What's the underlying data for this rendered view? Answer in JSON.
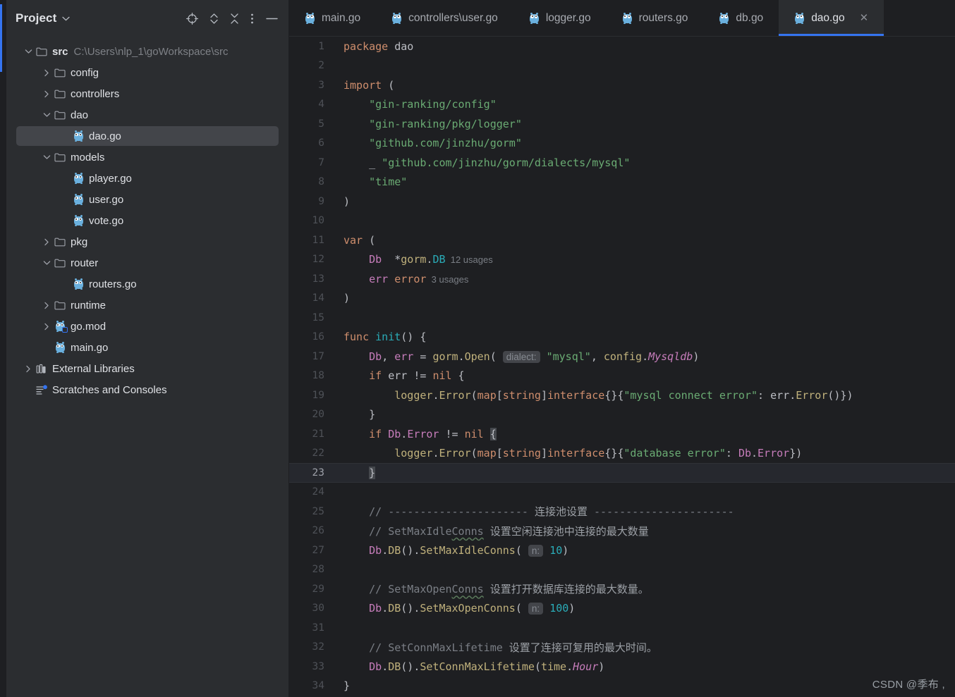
{
  "sidebar": {
    "title": "Project",
    "caret_glyph": "⌄",
    "tools": [
      {
        "name": "select-opened-file-icon",
        "label": "select opened file"
      },
      {
        "name": "expand-collapse-icon",
        "label": "expand all"
      },
      {
        "name": "collapse-all-icon",
        "label": "collapse all"
      },
      {
        "name": "more-options-icon",
        "label": "more options"
      },
      {
        "name": "minimize-icon",
        "label": "hide"
      }
    ],
    "tree": [
      {
        "label": "src",
        "path": "C:\\Users\\nlp_1\\goWorkspace\\src",
        "icon": "folder-icon",
        "arrow": "expanded",
        "depth": 0,
        "bold": true,
        "selected": false
      },
      {
        "label": "config",
        "path": "",
        "icon": "folder-icon",
        "arrow": "collapsed",
        "depth": 1,
        "bold": false,
        "selected": false
      },
      {
        "label": "controllers",
        "path": "",
        "icon": "folder-icon",
        "arrow": "collapsed",
        "depth": 1,
        "bold": false,
        "selected": false
      },
      {
        "label": "dao",
        "path": "",
        "icon": "folder-icon",
        "arrow": "expanded",
        "depth": 1,
        "bold": false,
        "selected": false
      },
      {
        "label": "dao.go",
        "path": "",
        "icon": "go-file-icon",
        "arrow": "none",
        "depth": 2,
        "bold": false,
        "selected": true
      },
      {
        "label": "models",
        "path": "",
        "icon": "folder-icon",
        "arrow": "expanded",
        "depth": 1,
        "bold": false,
        "selected": false
      },
      {
        "label": "player.go",
        "path": "",
        "icon": "go-file-icon",
        "arrow": "none",
        "depth": 2,
        "bold": false,
        "selected": false
      },
      {
        "label": "user.go",
        "path": "",
        "icon": "go-file-icon",
        "arrow": "none",
        "depth": 2,
        "bold": false,
        "selected": false
      },
      {
        "label": "vote.go",
        "path": "",
        "icon": "go-file-icon",
        "arrow": "none",
        "depth": 2,
        "bold": false,
        "selected": false
      },
      {
        "label": "pkg",
        "path": "",
        "icon": "folder-icon",
        "arrow": "collapsed",
        "depth": 1,
        "bold": false,
        "selected": false
      },
      {
        "label": "router",
        "path": "",
        "icon": "folder-icon",
        "arrow": "expanded",
        "depth": 1,
        "bold": false,
        "selected": false
      },
      {
        "label": "routers.go",
        "path": "",
        "icon": "go-file-icon",
        "arrow": "none",
        "depth": 2,
        "bold": false,
        "selected": false
      },
      {
        "label": "runtime",
        "path": "",
        "icon": "folder-icon",
        "arrow": "collapsed",
        "depth": 1,
        "bold": false,
        "selected": false
      },
      {
        "label": "go.mod",
        "path": "",
        "icon": "go-mod-icon",
        "arrow": "collapsed",
        "depth": 1,
        "bold": false,
        "selected": false
      },
      {
        "label": "main.go",
        "path": "",
        "icon": "go-file-icon",
        "arrow": "none",
        "depth": 1,
        "bold": false,
        "selected": false
      },
      {
        "label": "External Libraries",
        "path": "",
        "icon": "library-icon",
        "arrow": "collapsed",
        "depth": 0,
        "bold": false,
        "selected": false
      },
      {
        "label": "Scratches and Consoles",
        "path": "",
        "icon": "scratches-icon",
        "arrow": "none",
        "depth": 0,
        "bold": false,
        "selected": false
      }
    ]
  },
  "tabs": [
    {
      "label": "main.go",
      "icon": "go-file-icon",
      "active": false,
      "closable": false
    },
    {
      "label": "controllers\\user.go",
      "icon": "go-file-icon",
      "active": false,
      "closable": false
    },
    {
      "label": "logger.go",
      "icon": "go-file-icon",
      "active": false,
      "closable": false
    },
    {
      "label": "routers.go",
      "icon": "go-file-icon",
      "active": false,
      "closable": false
    },
    {
      "label": "db.go",
      "icon": "go-file-icon",
      "active": false,
      "closable": false
    },
    {
      "label": "dao.go",
      "icon": "go-file-icon",
      "active": true,
      "closable": true,
      "close_glyph": "✕"
    }
  ],
  "editor": {
    "current_line": 23,
    "lines": [
      {
        "n": 1,
        "tokens": [
          {
            "t": "kw",
            "v": "package"
          },
          {
            "t": "punc",
            "v": " "
          },
          {
            "t": "ident",
            "v": "dao"
          }
        ]
      },
      {
        "n": 2,
        "tokens": []
      },
      {
        "n": 3,
        "tokens": [
          {
            "t": "kw",
            "v": "import"
          },
          {
            "t": "punc",
            "v": " ("
          }
        ]
      },
      {
        "n": 4,
        "tokens": [
          {
            "t": "punc",
            "v": "    "
          },
          {
            "t": "str",
            "v": "\"gin-ranking/config\""
          }
        ]
      },
      {
        "n": 5,
        "tokens": [
          {
            "t": "punc",
            "v": "    "
          },
          {
            "t": "str",
            "v": "\"gin-ranking/pkg/logger\""
          }
        ]
      },
      {
        "n": 6,
        "tokens": [
          {
            "t": "punc",
            "v": "    "
          },
          {
            "t": "str",
            "v": "\"github.com/jinzhu/gorm\""
          }
        ]
      },
      {
        "n": 7,
        "tokens": [
          {
            "t": "punc",
            "v": "    _ "
          },
          {
            "t": "str",
            "v": "\"github.com/jinzhu/gorm/dialects/mysql\""
          }
        ]
      },
      {
        "n": 8,
        "tokens": [
          {
            "t": "punc",
            "v": "    "
          },
          {
            "t": "str",
            "v": "\"time\""
          }
        ]
      },
      {
        "n": 9,
        "tokens": [
          {
            "t": "punc",
            "v": ")"
          }
        ]
      },
      {
        "n": 10,
        "tokens": []
      },
      {
        "n": 11,
        "tokens": [
          {
            "t": "kw",
            "v": "var"
          },
          {
            "t": "punc",
            "v": " ("
          }
        ]
      },
      {
        "n": 12,
        "tokens": [
          {
            "t": "punc",
            "v": "    "
          },
          {
            "t": "fld",
            "v": "Db"
          },
          {
            "t": "punc",
            "v": "  *"
          },
          {
            "t": "fn",
            "v": "gorm"
          },
          {
            "t": "punc",
            "v": "."
          },
          {
            "t": "type",
            "v": "DB"
          },
          {
            "t": "usage",
            "v": "  12 usages"
          }
        ]
      },
      {
        "n": 13,
        "tokens": [
          {
            "t": "punc",
            "v": "    "
          },
          {
            "t": "fld",
            "v": "err"
          },
          {
            "t": "punc",
            "v": " "
          },
          {
            "t": "kw",
            "v": "error"
          },
          {
            "t": "usage",
            "v": "  3 usages"
          }
        ]
      },
      {
        "n": 14,
        "tokens": [
          {
            "t": "punc",
            "v": ")"
          }
        ]
      },
      {
        "n": 15,
        "tokens": []
      },
      {
        "n": 16,
        "tokens": [
          {
            "t": "kw",
            "v": "func"
          },
          {
            "t": "punc",
            "v": " "
          },
          {
            "t": "type",
            "v": "init"
          },
          {
            "t": "punc",
            "v": "() {"
          }
        ]
      },
      {
        "n": 17,
        "tokens": [
          {
            "t": "punc",
            "v": "    "
          },
          {
            "t": "fld",
            "v": "Db"
          },
          {
            "t": "punc",
            "v": ", "
          },
          {
            "t": "fld",
            "v": "err"
          },
          {
            "t": "punc",
            "v": " = "
          },
          {
            "t": "fn",
            "v": "gorm"
          },
          {
            "t": "punc",
            "v": "."
          },
          {
            "t": "fn",
            "v": "Open"
          },
          {
            "t": "punc",
            "v": "( "
          },
          {
            "t": "hint",
            "v": "dialect:"
          },
          {
            "t": "punc",
            "v": " "
          },
          {
            "t": "str",
            "v": "\"mysql\""
          },
          {
            "t": "punc",
            "v": ", "
          },
          {
            "t": "fn",
            "v": "config"
          },
          {
            "t": "punc",
            "v": "."
          },
          {
            "t": "cnst",
            "v": "Mysqldb"
          },
          {
            "t": "punc",
            "v": ")"
          }
        ]
      },
      {
        "n": 18,
        "tokens": [
          {
            "t": "punc",
            "v": "    "
          },
          {
            "t": "kw",
            "v": "if"
          },
          {
            "t": "punc",
            "v": " "
          },
          {
            "t": "ident",
            "v": "err"
          },
          {
            "t": "punc",
            "v": " != "
          },
          {
            "t": "kw",
            "v": "nil"
          },
          {
            "t": "punc",
            "v": " {"
          }
        ]
      },
      {
        "n": 19,
        "tokens": [
          {
            "t": "punc",
            "v": "        "
          },
          {
            "t": "fn",
            "v": "logger"
          },
          {
            "t": "punc",
            "v": "."
          },
          {
            "t": "fn",
            "v": "Error"
          },
          {
            "t": "punc",
            "v": "("
          },
          {
            "t": "kw",
            "v": "map"
          },
          {
            "t": "punc",
            "v": "["
          },
          {
            "t": "kw",
            "v": "string"
          },
          {
            "t": "punc",
            "v": "]"
          },
          {
            "t": "kw",
            "v": "interface"
          },
          {
            "t": "punc",
            "v": "{}{"
          },
          {
            "t": "str",
            "v": "\"mysql connect error\""
          },
          {
            "t": "punc",
            "v": ": "
          },
          {
            "t": "ident",
            "v": "err"
          },
          {
            "t": "punc",
            "v": "."
          },
          {
            "t": "fn",
            "v": "Error"
          },
          {
            "t": "punc",
            "v": "()})"
          }
        ]
      },
      {
        "n": 20,
        "tokens": [
          {
            "t": "punc",
            "v": "    }"
          }
        ]
      },
      {
        "n": 21,
        "tokens": [
          {
            "t": "punc",
            "v": "    "
          },
          {
            "t": "kw",
            "v": "if"
          },
          {
            "t": "punc",
            "v": " "
          },
          {
            "t": "fld",
            "v": "Db"
          },
          {
            "t": "punc",
            "v": "."
          },
          {
            "t": "fld",
            "v": "Error"
          },
          {
            "t": "punc",
            "v": " != "
          },
          {
            "t": "kw",
            "v": "nil"
          },
          {
            "t": "punc",
            "v": " "
          },
          {
            "t": "brace",
            "v": "{"
          }
        ]
      },
      {
        "n": 22,
        "tokens": [
          {
            "t": "punc",
            "v": "        "
          },
          {
            "t": "fn",
            "v": "logger"
          },
          {
            "t": "punc",
            "v": "."
          },
          {
            "t": "fn",
            "v": "Error"
          },
          {
            "t": "punc",
            "v": "("
          },
          {
            "t": "kw",
            "v": "map"
          },
          {
            "t": "punc",
            "v": "["
          },
          {
            "t": "kw",
            "v": "string"
          },
          {
            "t": "punc",
            "v": "]"
          },
          {
            "t": "kw",
            "v": "interface"
          },
          {
            "t": "punc",
            "v": "{}{"
          },
          {
            "t": "str",
            "v": "\"database error\""
          },
          {
            "t": "punc",
            "v": ": "
          },
          {
            "t": "fld",
            "v": "Db"
          },
          {
            "t": "punc",
            "v": "."
          },
          {
            "t": "fld",
            "v": "Error"
          },
          {
            "t": "punc",
            "v": "})"
          }
        ]
      },
      {
        "n": 23,
        "tokens": [
          {
            "t": "punc",
            "v": "    "
          },
          {
            "t": "brace",
            "v": "}"
          }
        ]
      },
      {
        "n": 24,
        "tokens": []
      },
      {
        "n": 25,
        "tokens": [
          {
            "t": "punc",
            "v": "    "
          },
          {
            "t": "cmt",
            "v": "// ---------------------- "
          },
          {
            "t": "cmtc",
            "v": "连接池设置"
          },
          {
            "t": "cmt",
            "v": " ----------------------"
          }
        ]
      },
      {
        "n": 26,
        "tokens": [
          {
            "t": "punc",
            "v": "    "
          },
          {
            "t": "cmt",
            "v": "// SetMaxIdle"
          },
          {
            "t": "spell",
            "v": "Conns"
          },
          {
            "t": "cmtc",
            "v": " 设置空闲连接池中连接的最大数量"
          }
        ]
      },
      {
        "n": 27,
        "tokens": [
          {
            "t": "punc",
            "v": "    "
          },
          {
            "t": "fld",
            "v": "Db"
          },
          {
            "t": "punc",
            "v": "."
          },
          {
            "t": "fn",
            "v": "DB"
          },
          {
            "t": "punc",
            "v": "()."
          },
          {
            "t": "fn",
            "v": "SetMaxIdleConns"
          },
          {
            "t": "punc",
            "v": "( "
          },
          {
            "t": "hint",
            "v": "n:"
          },
          {
            "t": "punc",
            "v": " "
          },
          {
            "t": "num",
            "v": "10"
          },
          {
            "t": "punc",
            "v": ")"
          }
        ]
      },
      {
        "n": 28,
        "tokens": []
      },
      {
        "n": 29,
        "tokens": [
          {
            "t": "punc",
            "v": "    "
          },
          {
            "t": "cmt",
            "v": "// SetMaxOpen"
          },
          {
            "t": "spell",
            "v": "Conns"
          },
          {
            "t": "cmtc",
            "v": " 设置打开数据库连接的最大数量。"
          }
        ]
      },
      {
        "n": 30,
        "tokens": [
          {
            "t": "punc",
            "v": "    "
          },
          {
            "t": "fld",
            "v": "Db"
          },
          {
            "t": "punc",
            "v": "."
          },
          {
            "t": "fn",
            "v": "DB"
          },
          {
            "t": "punc",
            "v": "()."
          },
          {
            "t": "fn",
            "v": "SetMaxOpenConns"
          },
          {
            "t": "punc",
            "v": "( "
          },
          {
            "t": "hint",
            "v": "n:"
          },
          {
            "t": "punc",
            "v": " "
          },
          {
            "t": "num",
            "v": "100"
          },
          {
            "t": "punc",
            "v": ")"
          }
        ]
      },
      {
        "n": 31,
        "tokens": []
      },
      {
        "n": 32,
        "tokens": [
          {
            "t": "punc",
            "v": "    "
          },
          {
            "t": "cmt",
            "v": "// SetConnMaxLifetime"
          },
          {
            "t": "cmtc",
            "v": " 设置了连接可复用的最大时间。"
          }
        ]
      },
      {
        "n": 33,
        "tokens": [
          {
            "t": "punc",
            "v": "    "
          },
          {
            "t": "fld",
            "v": "Db"
          },
          {
            "t": "punc",
            "v": "."
          },
          {
            "t": "fn",
            "v": "DB"
          },
          {
            "t": "punc",
            "v": "()."
          },
          {
            "t": "fn",
            "v": "SetConnMaxLifetime"
          },
          {
            "t": "punc",
            "v": "("
          },
          {
            "t": "fn",
            "v": "time"
          },
          {
            "t": "punc",
            "v": "."
          },
          {
            "t": "cnst",
            "v": "Hour"
          },
          {
            "t": "punc",
            "v": ")"
          }
        ]
      },
      {
        "n": 34,
        "tokens": [
          {
            "t": "punc",
            "v": "}"
          }
        ]
      }
    ]
  },
  "watermark": "CSDN @季布 ,",
  "colors": {
    "accent": "#3574f0",
    "sidebar_bg": "#2b2d30",
    "editor_bg": "#1e1f22",
    "selection_bg": "#43454a",
    "keyword": "#cf8e6d",
    "string": "#6aab73",
    "number": "#2aacb8",
    "comment": "#7a7e85",
    "function": "#c0b17c",
    "type": "#2aacb8",
    "field": "#c77dbb"
  }
}
